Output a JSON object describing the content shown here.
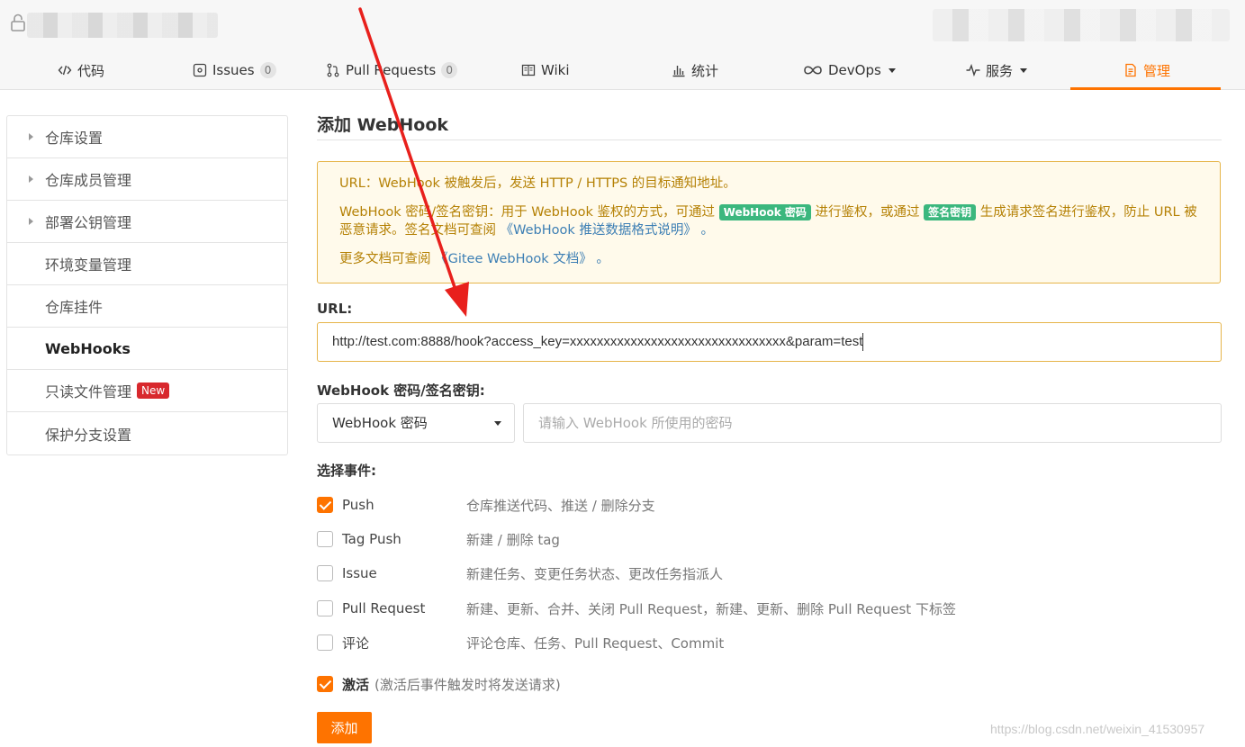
{
  "nav": {
    "items": [
      {
        "label": "代码",
        "icon": "code-icon"
      },
      {
        "label": "Issues",
        "icon": "issues-icon",
        "count": "0"
      },
      {
        "label": "Pull Requests",
        "icon": "pull-request-icon",
        "count": "0"
      },
      {
        "label": "Wiki",
        "icon": "wiki-icon"
      },
      {
        "label": "统计",
        "icon": "chart-icon"
      },
      {
        "label": "DevOps",
        "icon": "infinity-icon"
      },
      {
        "label": "服务",
        "icon": "pulse-icon"
      },
      {
        "label": "管理",
        "icon": "manage-icon"
      }
    ],
    "active": "管理"
  },
  "sidebar": {
    "items": [
      {
        "label": "仓库设置"
      },
      {
        "label": "仓库成员管理"
      },
      {
        "label": "部署公钥管理"
      },
      {
        "label": "环境变量管理"
      },
      {
        "label": "仓库挂件"
      },
      {
        "label": "WebHooks"
      },
      {
        "label": "只读文件管理",
        "badge": "New"
      },
      {
        "label": "保护分支设置"
      }
    ]
  },
  "main": {
    "title": "添加 WebHook",
    "notice": {
      "line1": "URL：WebHook 被触发后，发送 HTTP / HTTPS 的目标通知地址。",
      "line2_a": "WebHook 密码/签名密钥：用于 WebHook 鉴权的方式，可通过",
      "line2_tag1": "WebHook 密码",
      "line2_b": "进行鉴权，或通过",
      "line2_tag2": "签名密钥",
      "line2_c": "生成请求签名进行鉴权，防止 URL 被恶意请求。签名文档可查阅",
      "line2_link": "《WebHook 推送数据格式说明》",
      "line2_end": "。",
      "line3_a": "更多文档可查阅",
      "line3_link": "《Gitee WebHook 文档》",
      "line3_end": "。"
    },
    "url_label": "URL:",
    "url_value": "http://test.com:8888/hook?access_key=xxxxxxxxxxxxxxxxxxxxxxxxxxxxxxxx&param=test",
    "secret_label": "WebHook 密码/签名密钥:",
    "secret_type": "WebHook 密码",
    "secret_placeholder": "请输入 WebHook 所使用的密码",
    "events_label": "选择事件:",
    "events": [
      {
        "name": "Push",
        "desc": "仓库推送代码、推送 / 删除分支",
        "checked": true
      },
      {
        "name": "Tag Push",
        "desc": "新建 / 删除 tag",
        "checked": false
      },
      {
        "name": "Issue",
        "desc": "新建任务、变更任务状态、更改任务指派人",
        "checked": false
      },
      {
        "name": "Pull Request",
        "desc": "新建、更新、合并、关闭 Pull Request，新建、更新、删除 Pull Request 下标签",
        "checked": false
      },
      {
        "name": "评论",
        "desc": "评论仓库、任务、Pull Request、Commit",
        "checked": false
      }
    ],
    "activate_label": "激活",
    "activate_hint": "(激活后事件触发时将发送请求)",
    "activate_checked": true,
    "submit_label": "添加"
  },
  "watermark": "https://blog.csdn.net/weixin_41530957",
  "colors": {
    "accent": "#fe7300",
    "notice_text": "#b58105",
    "notice_border": "#e6b54a",
    "tag_green": "#3bb77e",
    "badge_red": "#d8282d",
    "annotation_arrow": "#e8201c"
  }
}
